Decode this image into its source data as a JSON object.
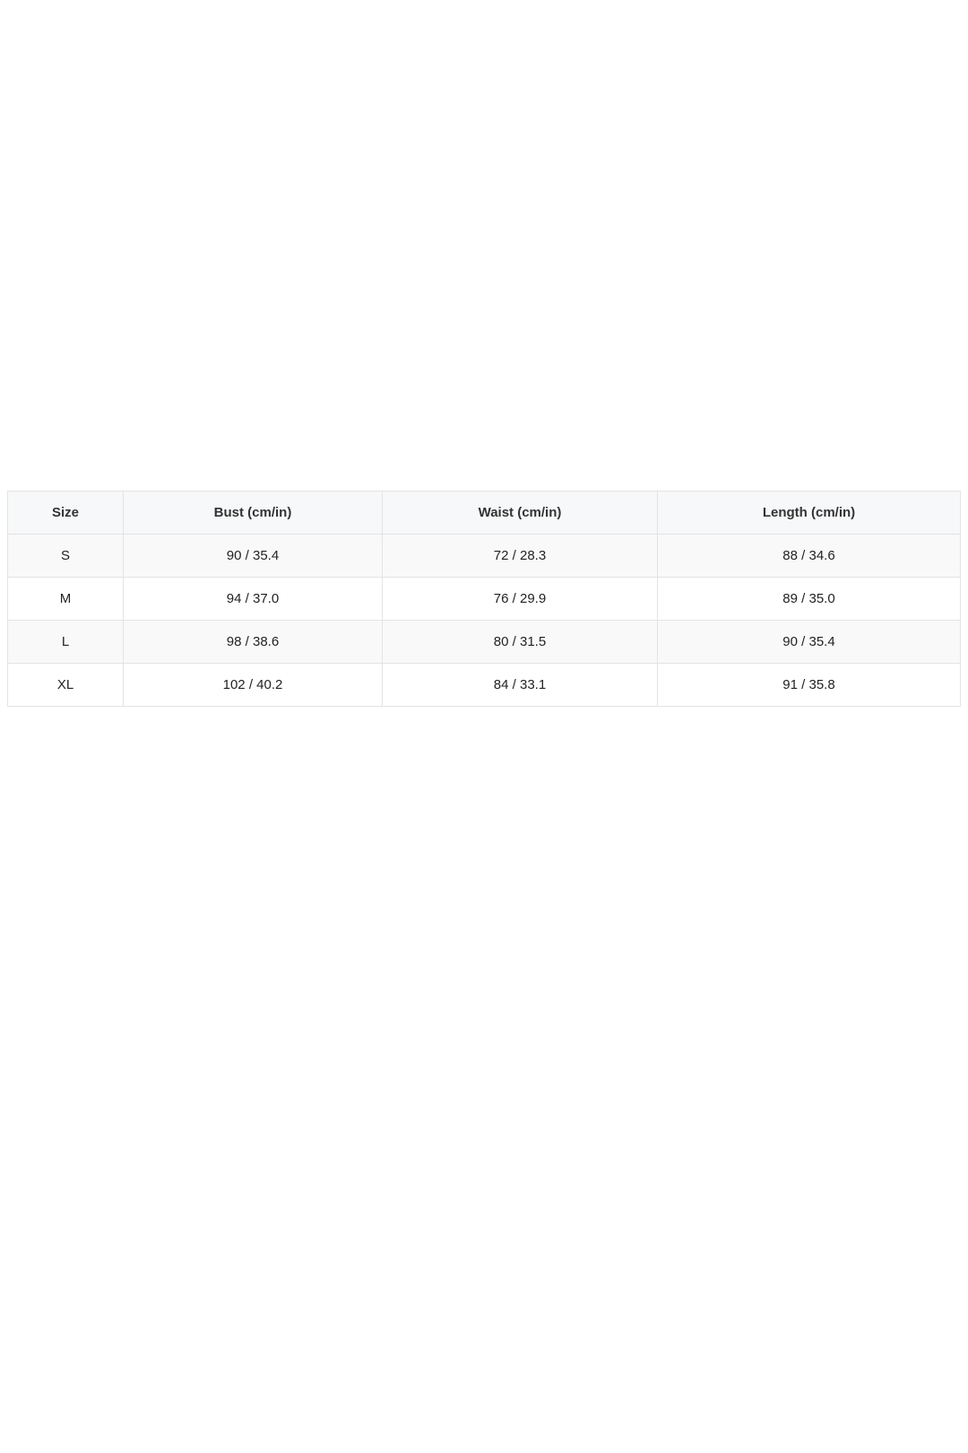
{
  "table": {
    "headers": [
      "Size",
      "Bust (cm/in)",
      "Waist (cm/in)",
      "Length (cm/in)"
    ],
    "rows": [
      [
        "S",
        "90 / 35.4",
        "72 / 28.3",
        "88 / 34.6"
      ],
      [
        "M",
        "94 / 37.0",
        "76 / 29.9",
        "89 / 35.0"
      ],
      [
        "L",
        "98 / 38.6",
        "80 / 31.5",
        "90 / 35.4"
      ],
      [
        "XL",
        "102 / 40.2",
        "84 / 33.1",
        "91 / 35.8"
      ]
    ]
  }
}
